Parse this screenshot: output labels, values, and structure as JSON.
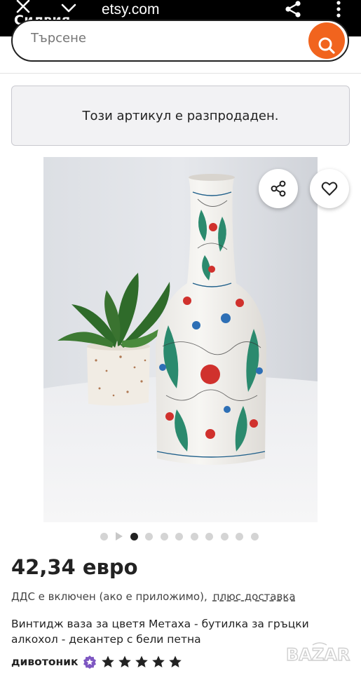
{
  "browser": {
    "profile_name": "Силвия",
    "url": "etsy.com",
    "icons": [
      "close-icon",
      "chevron-down-icon",
      "share-icon",
      "more-vertical-icon"
    ]
  },
  "search": {
    "placeholder": "Търсене",
    "icon": "search-icon"
  },
  "notice": {
    "text": "Този артикул е разпродаден."
  },
  "product": {
    "image_actions": [
      "share-icon",
      "heart-icon"
    ],
    "carousel": {
      "total_images": 10,
      "active_index": 1,
      "has_video": true
    },
    "price": "42,34 евро",
    "vat_note": "ДДС е включен (ако е приложимо),",
    "shipping_link": "плюс доставка",
    "title": "Винтидж ваза за цветя Метаха - бутилка за гръцки алкохол - декантер с бели петна",
    "shop_name": "дивотоник",
    "rating": 5,
    "max_rating": 5
  },
  "colors": {
    "accent": "#f1641e",
    "text": "#222222",
    "notice_bg": "#f2f2f4"
  }
}
